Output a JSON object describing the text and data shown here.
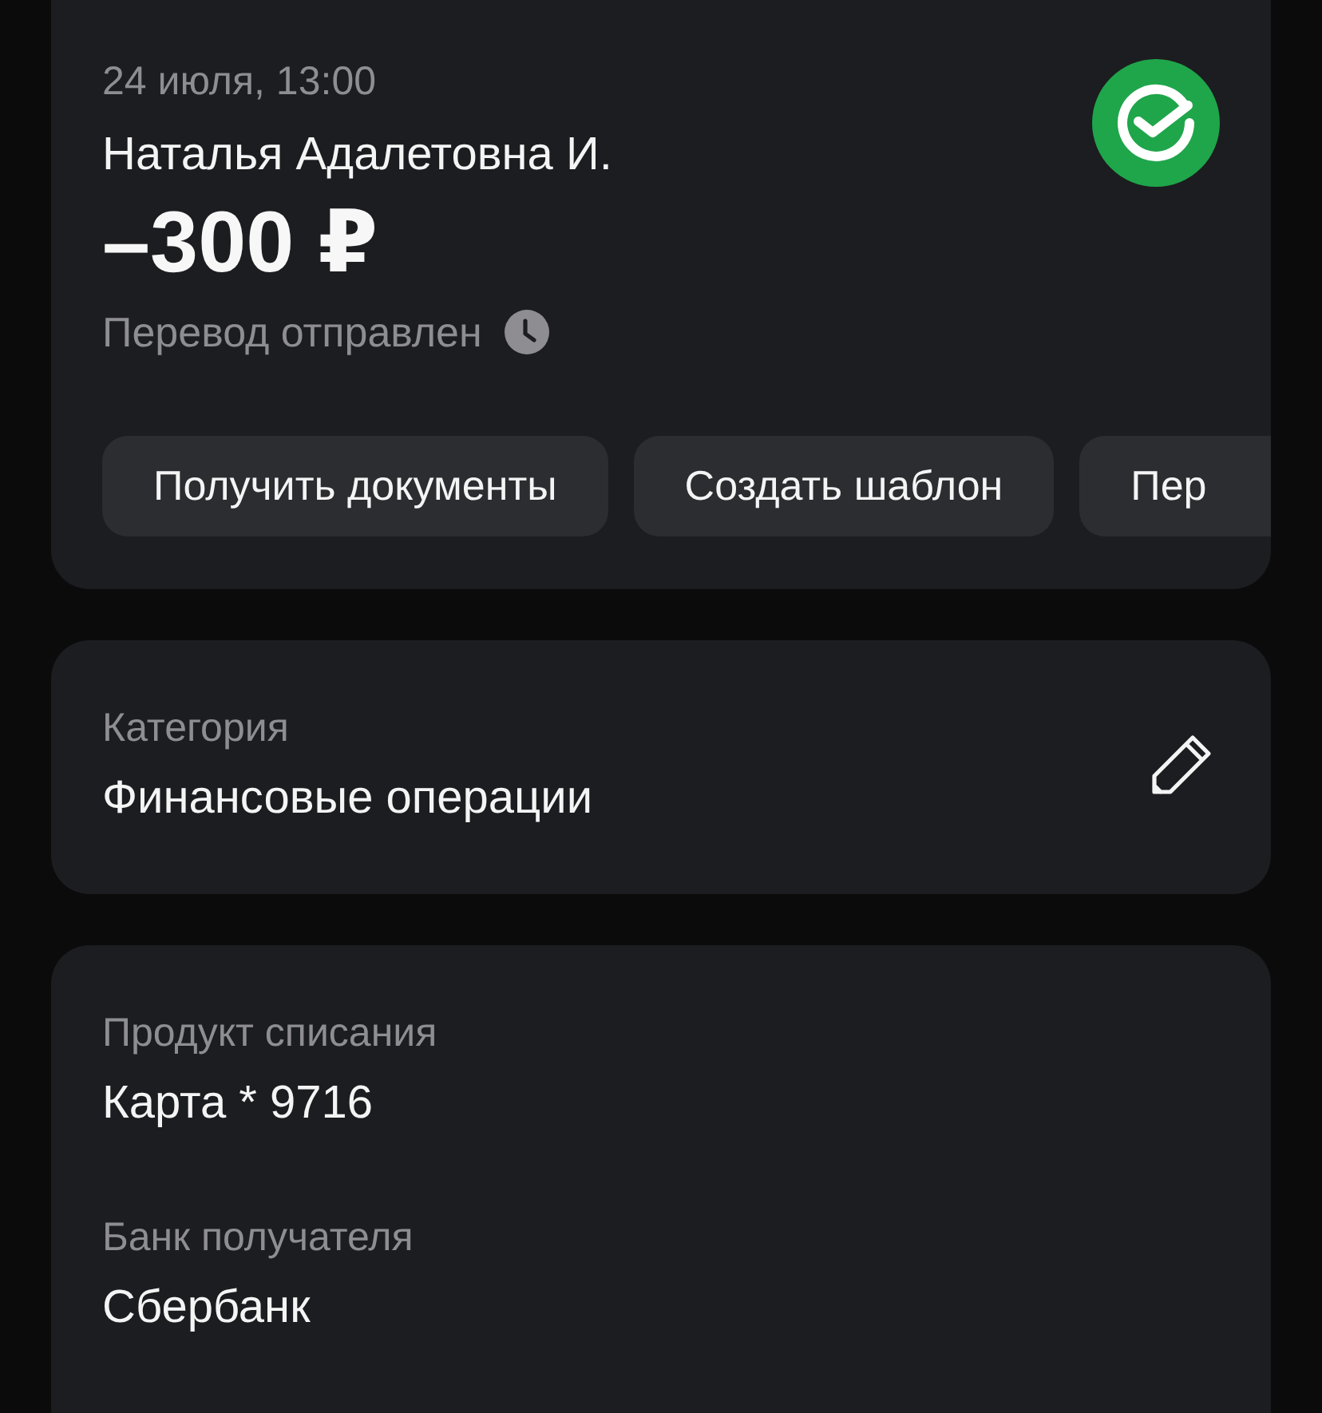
{
  "transaction": {
    "date": "24 июля, 13:00",
    "recipient": "Наталья Адалетовна И.",
    "amount": "–300 ₽",
    "status": "Перевод отправлен"
  },
  "actions": [
    "Получить документы",
    "Создать шаблон",
    "Пер"
  ],
  "category": {
    "label": "Категория",
    "value": "Финансовые операции"
  },
  "details": [
    {
      "label": "Продукт списания",
      "value": "Карта * 9716"
    },
    {
      "label": "Банк получателя",
      "value": "Сбербанк"
    }
  ]
}
